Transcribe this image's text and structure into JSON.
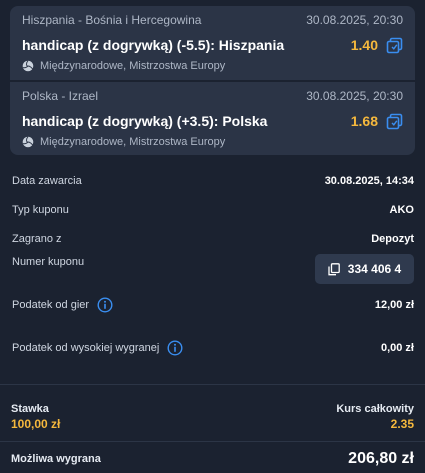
{
  "bets": [
    {
      "match": "Hiszpania - Bośnia i Hercegowina",
      "datetime": "30.08.2025, 20:30",
      "selection": "handicap (z dogrywką) (-5.5): Hiszpania",
      "odds": "1.40",
      "competition": "Międzynarodowe, Mistrzostwa Europy"
    },
    {
      "match": "Polska - Izrael",
      "datetime": "30.08.2025, 20:30",
      "selection": "handicap (z dogrywką) (+3.5): Polska",
      "odds": "1.68",
      "competition": "Międzynarodowe, Mistrzostwa Europy"
    }
  ],
  "details": {
    "date_label": "Data zawarcia",
    "date_value": "30.08.2025, 14:34",
    "type_label": "Typ kuponu",
    "type_value": "AKO",
    "played_label": "Zagrano z",
    "played_value": "Depozyt",
    "number_label": "Numer kuponu",
    "number_value": "334 406 4",
    "tax_label": "Podatek od gier",
    "tax_value": "12,00 zł",
    "tax_high_label": "Podatek od wysokiej wygranej",
    "tax_high_value": "0,00 zł"
  },
  "summary": {
    "stake_label": "Stawka",
    "stake_value": "100,00 zł",
    "total_odds_label": "Kurs całkowity",
    "total_odds_value": "2.35",
    "win_label": "Możliwa wygrana",
    "win_value": "206,80 zł"
  },
  "colors": {
    "background": "#1b2230",
    "card": "#2b3446",
    "accent_odds": "#f5b83d",
    "icon_blue": "#3a8ef0"
  },
  "icons": {
    "odds_icon": "copy-odds-icon",
    "sport_icon": "volleyball-icon",
    "coupon_icon": "copy-icon",
    "tax_info_icon": "info-icon"
  }
}
